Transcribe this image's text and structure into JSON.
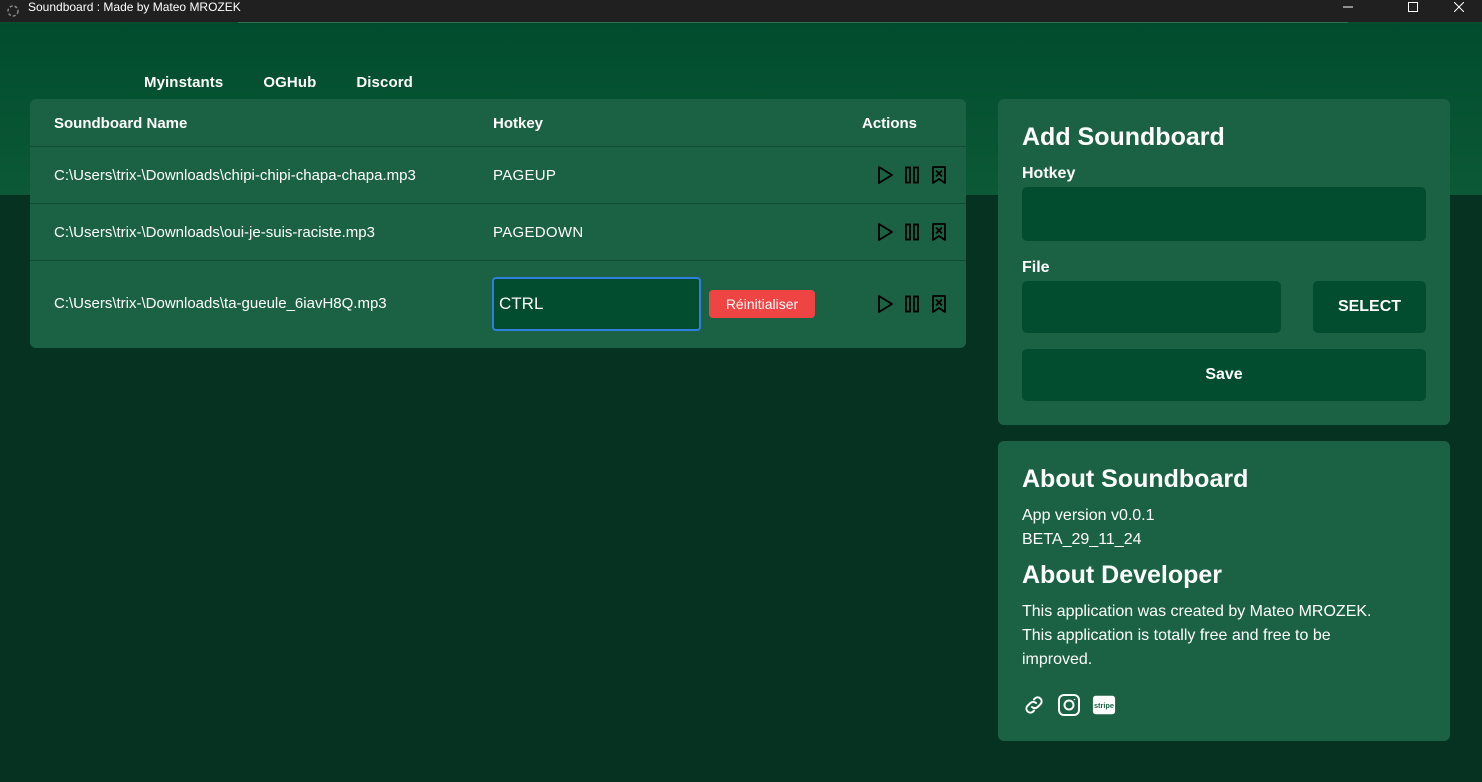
{
  "window": {
    "title": "Soundboard : Made by Mateo MROZEK",
    "controls": [
      "minimize-icon",
      "maximize-icon",
      "close-icon"
    ]
  },
  "nav": {
    "links": [
      {
        "label": "Myinstants"
      },
      {
        "label": "OGHub"
      },
      {
        "label": "Discord"
      }
    ]
  },
  "table": {
    "headers": {
      "name": "Soundboard Name",
      "hotkey": "Hotkey",
      "actions": "Actions"
    },
    "rows": [
      {
        "name": "C:\\Users\\trix-\\Downloads\\chipi-chipi-chapa-chapa.mp3",
        "hotkey": "PAGEUP"
      },
      {
        "name": "C:\\Users\\trix-\\Downloads\\oui-je-suis-raciste.mp3",
        "hotkey": "PAGEDOWN"
      },
      {
        "name": "C:\\Users\\trix-\\Downloads\\ta-gueule_6iavH8Q.mp3",
        "hotkey": "CTRL",
        "editing": true,
        "reset_label": "Réinitialiser"
      }
    ],
    "action_icons": [
      "play-icon",
      "pause-icon",
      "delete-icon"
    ]
  },
  "add_soundboard": {
    "title": "Add Soundboard",
    "hotkey_label": "Hotkey",
    "hotkey_value": "",
    "file_label": "File",
    "file_value": "",
    "select_label": "SELECT",
    "save_label": "Save"
  },
  "about": {
    "title": "About Soundboard",
    "version": "App version v0.0.1",
    "build": "BETA_29_11_24",
    "dev_title": "About Developer",
    "dev_line1": "This application was created by Mateo MROZEK.",
    "dev_line2": "This application is totally free and free to be",
    "dev_line3": "improved.",
    "link_icons": [
      "link-icon",
      "instagram-icon",
      "stripe-icon"
    ],
    "stripe_text": "stripe"
  },
  "colors": {
    "background": "#063222",
    "hero": "#004c2d",
    "card": "#1b6245",
    "field": "#024d2f",
    "accent_red": "#ef4444",
    "focus_blue": "#2f7fe0"
  }
}
